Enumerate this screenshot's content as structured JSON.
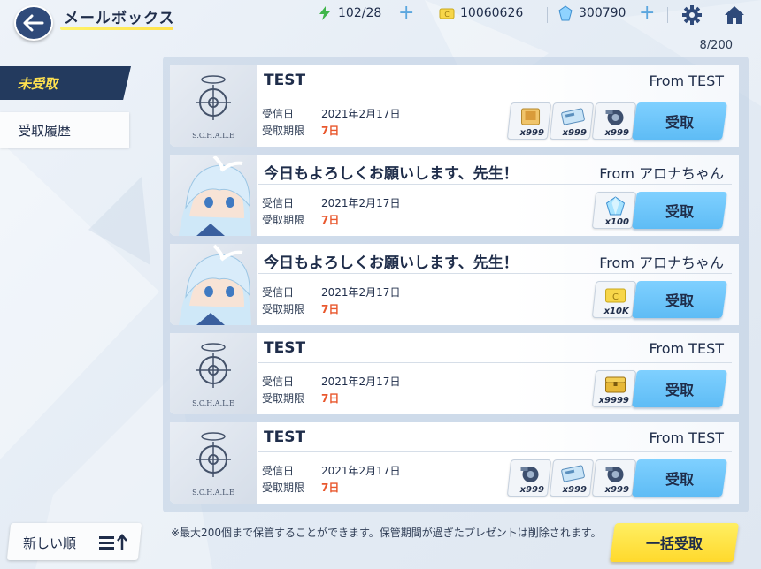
{
  "header": {
    "title": "メールボックス",
    "ap": "102/28",
    "credits": "10060626",
    "gems": "300790",
    "plus": "+"
  },
  "mail_count": "8/200",
  "tabs": {
    "unclaimed": "未受取",
    "history": "受取履歴"
  },
  "labels": {
    "received": "受信日",
    "deadline": "受取期限",
    "claim": "受取"
  },
  "avatar_text": "S.C.H.A.L.E",
  "mails": [
    {
      "title": "TEST",
      "from": "From TEST",
      "date": "2021年2月17日",
      "limit": "7日",
      "avatar": "schale-logo",
      "items": [
        {
          "icon": "book-icon",
          "qty": "x999"
        },
        {
          "icon": "disk-icon",
          "qty": "x999"
        },
        {
          "icon": "gear-part-icon",
          "qty": "x999"
        }
      ]
    },
    {
      "title": "今日もよろしくお願いします、先生！",
      "from": "From アロナちゃん",
      "date": "2021年2月17日",
      "limit": "7日",
      "avatar": "arona-portrait",
      "items": [
        {
          "icon": "gem-icon",
          "qty": "x100"
        }
      ]
    },
    {
      "title": "今日もよろしくお願いします、先生！",
      "from": "From アロナちゃん",
      "date": "2021年2月17日",
      "limit": "7日",
      "avatar": "arona-portrait",
      "items": [
        {
          "icon": "credit-card-icon",
          "qty": "x10K"
        }
      ]
    },
    {
      "title": "TEST",
      "from": "From TEST",
      "date": "2021年2月17日",
      "limit": "7日",
      "avatar": "schale-logo",
      "items": [
        {
          "icon": "gold-chest-icon",
          "qty": "x9999"
        }
      ]
    },
    {
      "title": "TEST",
      "from": "From TEST",
      "date": "2021年2月17日",
      "limit": "7日",
      "avatar": "schale-logo",
      "items": [
        {
          "icon": "gear-part-icon",
          "qty": "x999"
        },
        {
          "icon": "disk-icon",
          "qty": "x999"
        },
        {
          "icon": "gear-part-icon",
          "qty": "x999"
        }
      ]
    }
  ],
  "sort_label": "新しい順",
  "notice": "※最大200個まで保管することができます。保管期間が過ぎたプレゼントは削除されます。",
  "claim_all": "一括受取"
}
